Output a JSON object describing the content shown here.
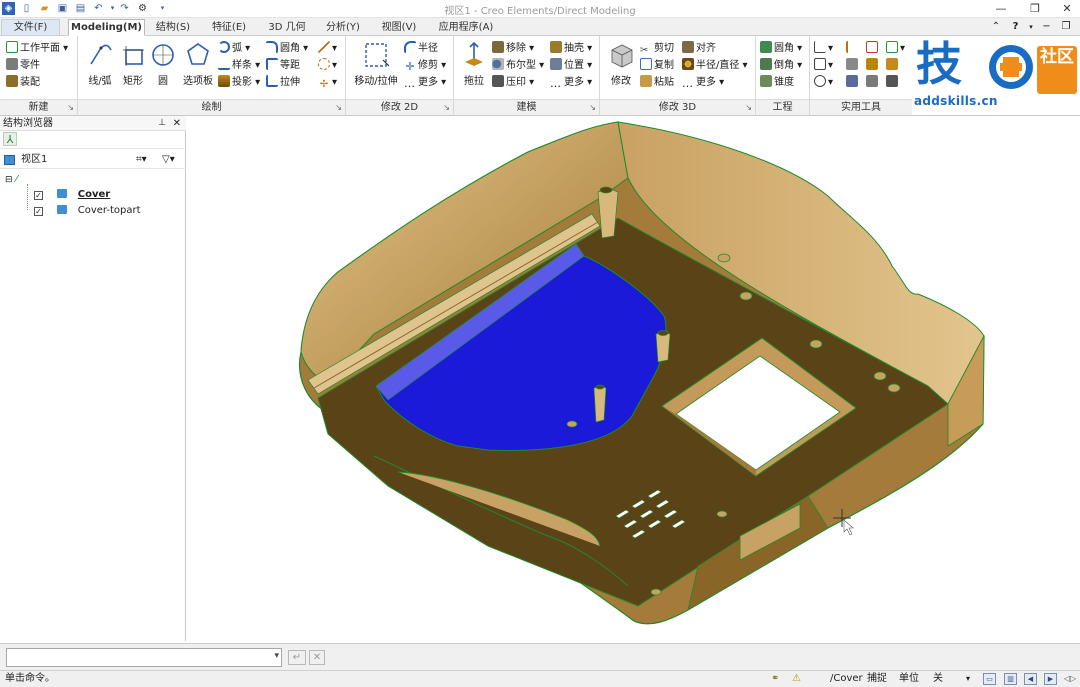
{
  "title": "视区1 - Creo Elements/Direct Modeling",
  "tabs": [
    "文件(F)",
    "Modeling(M)",
    "结构(S)",
    "特征(E)",
    "3D 几何",
    "分析(Y)",
    "视图(V)",
    "应用程序(A)"
  ],
  "ribbon": {
    "new_group": {
      "label": "新建",
      "items": [
        "工作平面",
        "零件",
        "装配"
      ]
    },
    "draw_group": {
      "label": "绘制",
      "big": [
        "线/弧",
        "矩形",
        "圆",
        "选项板"
      ],
      "col1": [
        "弧",
        "样条",
        "投影"
      ],
      "col2": [
        "圆角",
        "等距",
        "拉伸"
      ]
    },
    "modify2d_group": {
      "label": "修改 2D",
      "big": [
        "移动/拉伸"
      ],
      "items": [
        "半径",
        "修剪",
        "更多"
      ]
    },
    "model_group": {
      "label": "建模",
      "big": [
        "拖拉"
      ],
      "col1": [
        "移除",
        "布尔型",
        "压印"
      ],
      "col2": [
        "抽壳",
        "位置",
        "更多"
      ]
    },
    "modify3d_group": {
      "label": "修改 3D",
      "big": [
        "修改"
      ],
      "col1": [
        "剪切",
        "复制",
        "粘贴"
      ],
      "col2": [
        "对齐",
        "半径/直径",
        "更多"
      ]
    },
    "eng_group": {
      "label": "工程",
      "items": [
        "圆角",
        "倒角",
        "锥度"
      ]
    },
    "tools_group": {
      "label": "实用工具"
    }
  },
  "logo": {
    "cn": "技",
    "badge": "社区",
    "url": "addskills.cn"
  },
  "browser": {
    "title": "结构浏览器",
    "view_name": "视区1",
    "items": [
      "Cover",
      "Cover-topart"
    ]
  },
  "status": {
    "prompt": "单击命令。",
    "part": "/Cover",
    "snap": "捕捉",
    "unit": "单位",
    "state": "关"
  },
  "colors": {
    "part_brown": "#5b4318",
    "wall_tan": "#c8a265",
    "edge_green": "#1e8a2a",
    "highlight_blue": "#1a1ad8"
  }
}
